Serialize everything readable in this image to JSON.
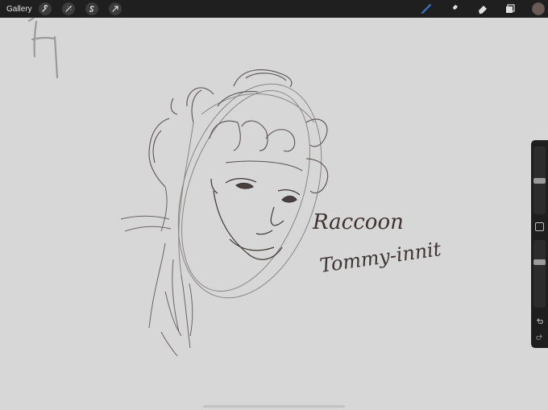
{
  "toolbar": {
    "gallery_label": "Gallery",
    "left_tools": [
      "wrench-icon",
      "magic-wand-icon",
      "selection-icon",
      "transform-arrow-icon"
    ],
    "right_tools": [
      "brush-icon",
      "smudge-icon",
      "eraser-icon",
      "layers-icon"
    ],
    "active_tool": "brush-icon",
    "accent_color": "#3a7bd5",
    "current_color": "#6e5a54"
  },
  "canvas": {
    "background": "#d7d7d7",
    "stroke_color": "#4a4040",
    "handwriting": {
      "line1": "Raccoon",
      "line2": "Tommy-innit"
    }
  },
  "sidebar": {
    "brush_size_level": 0.5,
    "opacity_level": 0.38,
    "icons": [
      "modify-square-icon",
      "undo-icon",
      "redo-icon"
    ]
  }
}
